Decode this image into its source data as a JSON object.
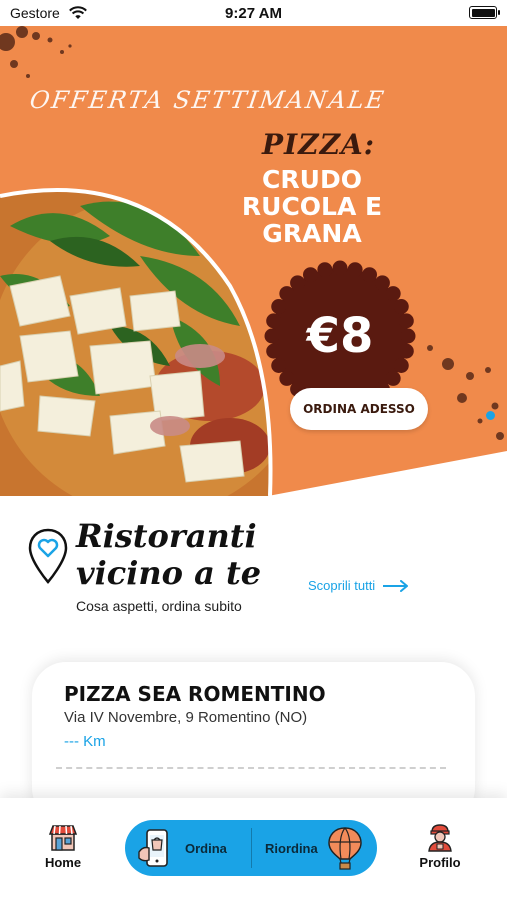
{
  "status_bar": {
    "carrier": "Gestore",
    "time": "9:27 AM"
  },
  "banner": {
    "kicker": "OFFERTA SETTIMANALE",
    "pizza_label": "PIZZA:",
    "title_lines": [
      "CRUDO",
      "RUCOLA E",
      "GRANA"
    ],
    "price": "€8",
    "cta_label": "ORDINA ADESSO",
    "colors": {
      "background": "#f08a4b",
      "price_badge": "#5a1a10",
      "dots": "#1aa3e6"
    }
  },
  "nearby": {
    "title_line1": "Ristoranti",
    "title_line2": "vicino a te",
    "subtitle": "Cosa aspetti, ordina subito",
    "discover_label": "Scoprili tutti"
  },
  "restaurant": {
    "name": "PIZZA SEA ROMENTINO",
    "address": "Via IV Novembre, 9 Romentino (NO)",
    "distance": "--- Km"
  },
  "nav": {
    "home_label": "Home",
    "order_label": "Ordina",
    "reorder_label": "Riordina",
    "profile_label": "Profilo",
    "accent_color": "#1aa3e6"
  }
}
